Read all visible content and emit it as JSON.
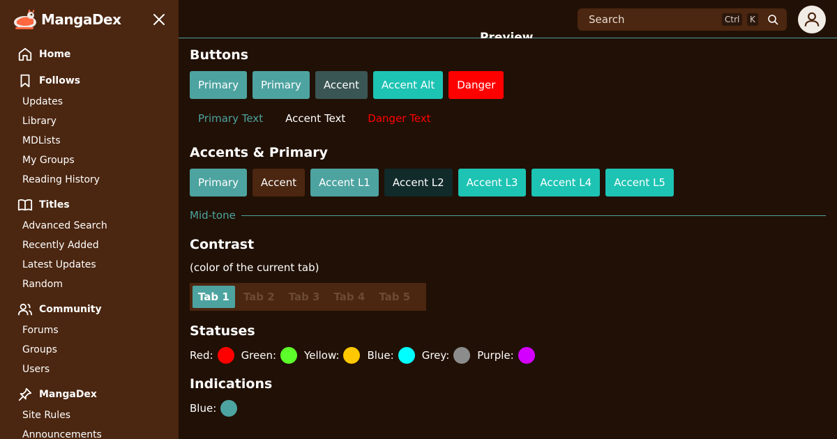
{
  "brand": {
    "name": "MangaDex"
  },
  "sidebar": {
    "sections": [
      {
        "title": "Home",
        "icon": "home-icon",
        "items": []
      },
      {
        "title": "Follows",
        "icon": "bookmark-icon",
        "items": [
          "Updates",
          "Library",
          "MDLists",
          "My Groups",
          "Reading History"
        ]
      },
      {
        "title": "Titles",
        "icon": "book-icon",
        "items": [
          "Advanced Search",
          "Recently Added",
          "Latest Updates",
          "Random"
        ]
      },
      {
        "title": "Community",
        "icon": "users-icon",
        "items": [
          "Forums",
          "Groups",
          "Users"
        ]
      },
      {
        "title": "MangaDex",
        "icon": "pin-icon",
        "items": [
          "Site Rules",
          "Announcements"
        ]
      }
    ]
  },
  "search": {
    "placeholder": "Search",
    "kbd_ctrl": "Ctrl",
    "kbd_k": "K"
  },
  "preview": {
    "heading": "Preview"
  },
  "buttons_section": {
    "title": "Buttons",
    "buttons": [
      {
        "label": "Primary",
        "bg": "#4da3a0"
      },
      {
        "label": "Primary",
        "bg": "#4da3a0"
      },
      {
        "label": "Accent",
        "bg": "#3a5654"
      },
      {
        "label": "Accent Alt",
        "bg": "#1dc3b3"
      },
      {
        "label": "Danger",
        "bg": "#ff0000"
      }
    ],
    "text_buttons": [
      {
        "label": "Primary Text",
        "color": "#4da3a0"
      },
      {
        "label": "Accent Text",
        "color": "#ffffff"
      },
      {
        "label": "Danger Text",
        "color": "#ff0000"
      }
    ]
  },
  "accents_section": {
    "title": "Accents & Primary",
    "buttons": [
      {
        "label": "Primary",
        "bg": "#4da3a0"
      },
      {
        "label": "Accent",
        "bg": "#4b2610"
      },
      {
        "label": "Accent L1",
        "bg": "#4da3a0"
      },
      {
        "label": "Accent L2",
        "bg": "#112a2a"
      },
      {
        "label": "Accent L3",
        "bg": "#1dc3b3"
      },
      {
        "label": "Accent L4",
        "bg": "#1dc3b3"
      },
      {
        "label": "Accent L5",
        "bg": "#1dc3b3"
      }
    ],
    "midtone_label": "Mid-tone"
  },
  "contrast_section": {
    "title": "Contrast",
    "subtitle": "(color of the current tab)",
    "tabs": [
      "Tab 1",
      "Tab 2",
      "Tab 3",
      "Tab 4",
      "Tab 5"
    ],
    "active_tab": 0
  },
  "statuses_section": {
    "title": "Statuses",
    "items": [
      {
        "label": "Red:",
        "color": "#ff0000"
      },
      {
        "label": "Green:",
        "color": "#5dff2a"
      },
      {
        "label": "Yellow:",
        "color": "#ffc800"
      },
      {
        "label": "Blue:",
        "color": "#00ffff"
      },
      {
        "label": "Grey:",
        "color": "#8c8c8c"
      },
      {
        "label": "Purple:",
        "color": "#d400ff"
      }
    ]
  },
  "indications_section": {
    "title": "Indications",
    "items": [
      {
        "label": "Blue:",
        "color": "#4da3a0"
      }
    ]
  }
}
